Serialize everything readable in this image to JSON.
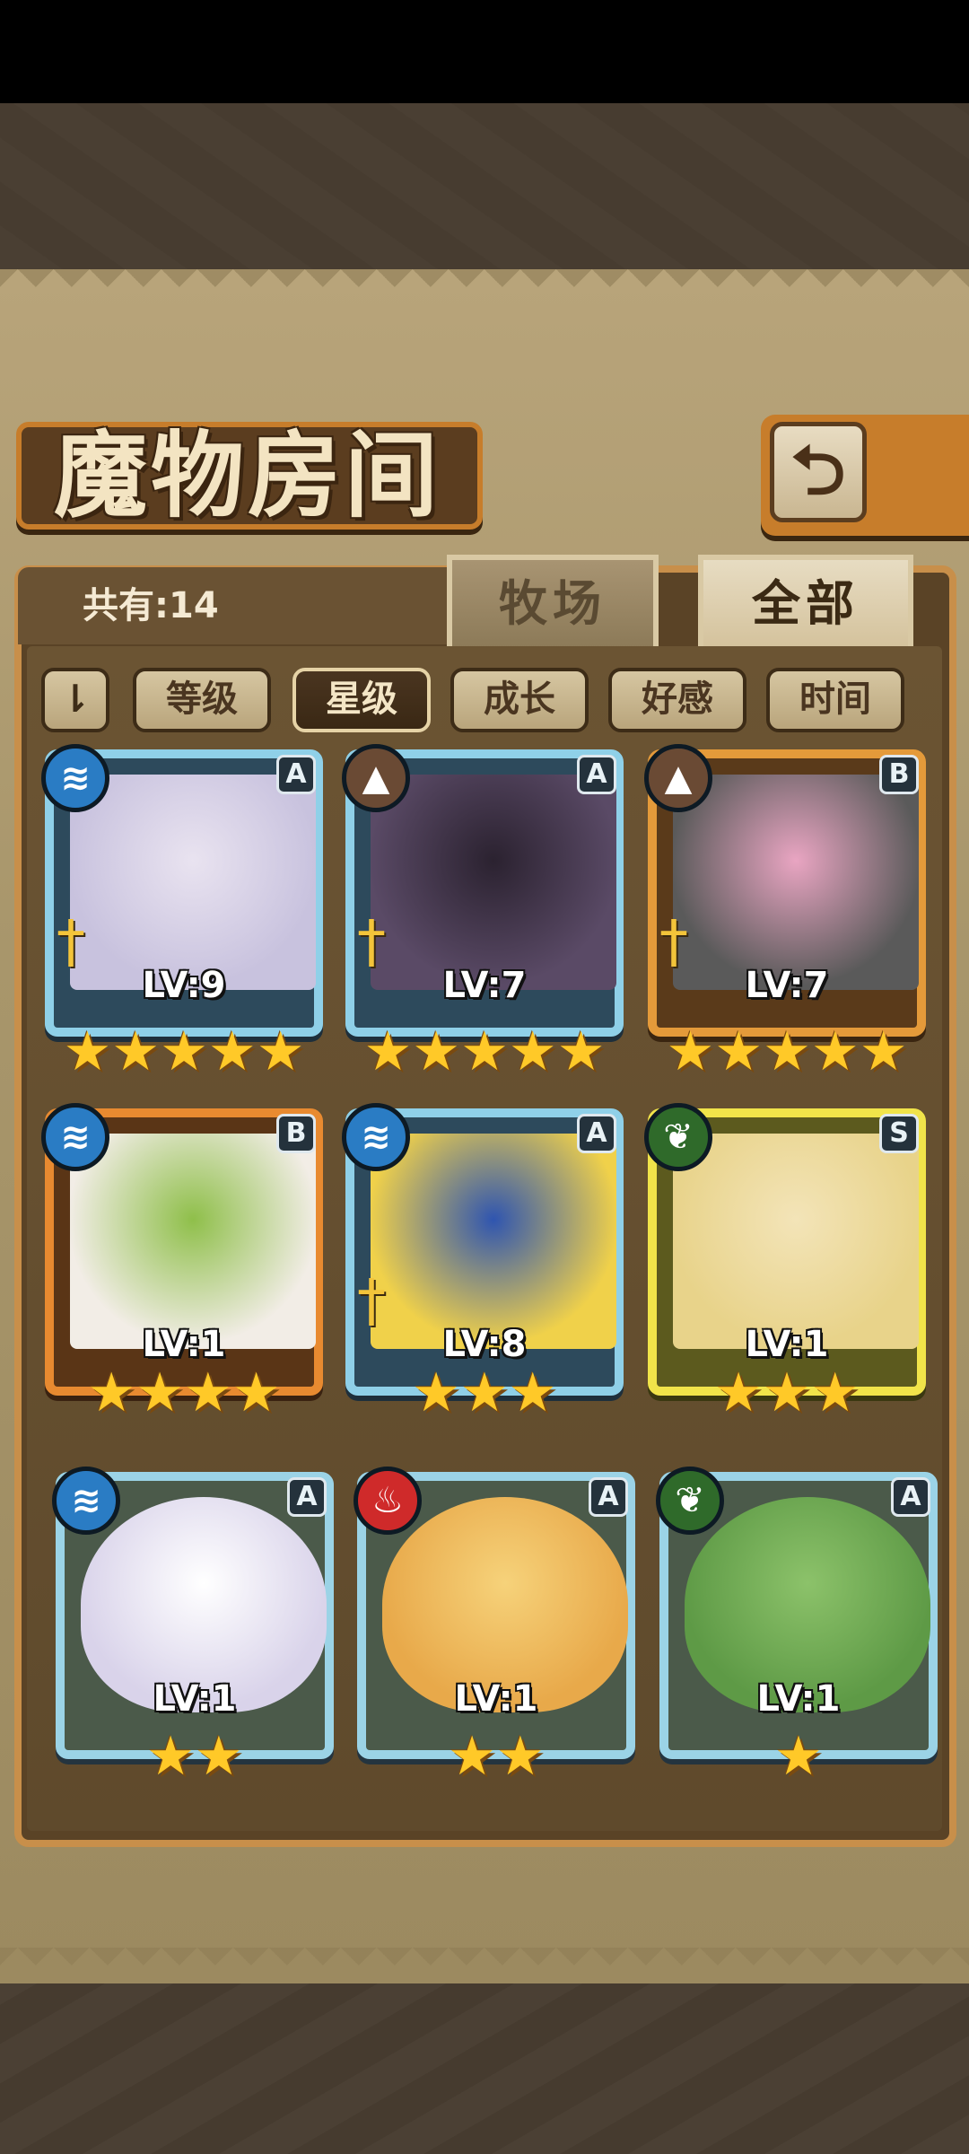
{
  "header": {
    "title": "魔物房间",
    "back_icon": "⮌"
  },
  "summary": {
    "count_label": "共有:14"
  },
  "tabs": [
    {
      "label": "牧场",
      "active": false
    },
    {
      "label": "全部",
      "active": true
    }
  ],
  "filters": {
    "sort_toggle": "⇂",
    "items": [
      {
        "label": "等级",
        "active": false
      },
      {
        "label": "星级",
        "active": true
      },
      {
        "label": "成长",
        "active": false
      },
      {
        "label": "好感",
        "active": false
      },
      {
        "label": "时间",
        "active": false
      }
    ]
  },
  "monsters": [
    {
      "element": "water",
      "element_glyph": "≋",
      "rank": "A",
      "level": "LV:9",
      "stars": 5,
      "frame": "blue",
      "colors": [
        "#e9e3f0",
        "#c8c2de"
      ]
    },
    {
      "element": "earth",
      "element_glyph": "▲",
      "rank": "A",
      "level": "LV:7",
      "stars": 5,
      "frame": "blue",
      "colors": [
        "#2b2230",
        "#5a4a66"
      ]
    },
    {
      "element": "earth",
      "element_glyph": "▲",
      "rank": "B",
      "level": "LV:7",
      "stars": 5,
      "frame": "gold",
      "colors": [
        "#e9a5c2",
        "#5a5a5a"
      ]
    },
    {
      "element": "water",
      "element_glyph": "≋",
      "rank": "B",
      "level": "LV:1",
      "stars": 4,
      "frame": "orange",
      "colors": [
        "#8fbf4a",
        "#f2ede6"
      ]
    },
    {
      "element": "water",
      "element_glyph": "≋",
      "rank": "A",
      "level": "LV:8",
      "stars": 3,
      "frame": "blue",
      "colors": [
        "#2f55b0",
        "#f0d14a"
      ]
    },
    {
      "element": "wood",
      "element_glyph": "❦",
      "rank": "S",
      "level": "LV:1",
      "stars": 3,
      "frame": "yellow",
      "colors": [
        "#f3e4b8",
        "#e8d38a"
      ]
    },
    {
      "element": "water",
      "element_glyph": "≋",
      "rank": "A",
      "level": "LV:1",
      "stars": 2,
      "frame": "plain",
      "colors": [
        "#ffffff",
        "#d9d3ea"
      ]
    },
    {
      "element": "fire",
      "element_glyph": "♨",
      "rank": "A",
      "level": "LV:1",
      "stars": 2,
      "frame": "plain",
      "colors": [
        "#f6d27a",
        "#e8a94a"
      ]
    },
    {
      "element": "wood",
      "element_glyph": "❦",
      "rank": "A",
      "level": "LV:1",
      "stars": 1,
      "frame": "plain",
      "colors": [
        "#8cc26a",
        "#5e9a46"
      ]
    }
  ]
}
